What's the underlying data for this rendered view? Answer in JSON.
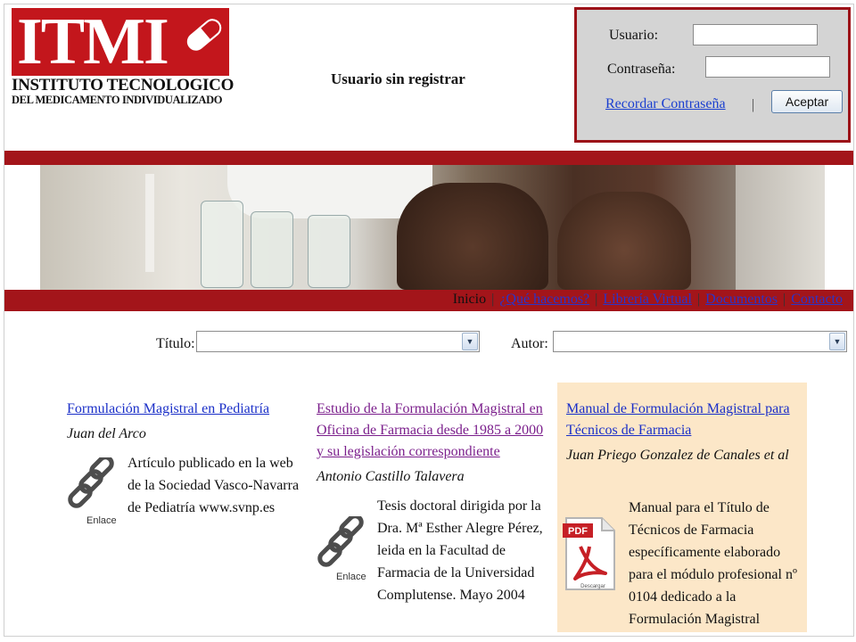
{
  "header": {
    "logo_main": "ITMI",
    "logo_sub1": "INSTITUTO TECNOLOGICO",
    "logo_sub2": "DEL MEDICAMENTO INDIVIDUALIZADO",
    "user_status": "Usuario sin registrar"
  },
  "login": {
    "user_label": "Usuario:",
    "user_value": "",
    "password_label": "Contraseña:",
    "password_value": "",
    "remember_link": "Recordar Contraseña",
    "separator": "|",
    "accept_button": "Aceptar"
  },
  "nav": {
    "items": [
      "Inicio",
      "¿Qué hacemos?",
      "Librería Virtual",
      "Documentos",
      "Contacto"
    ],
    "separator": "|"
  },
  "filters": {
    "title_label": "Título:",
    "title_value": "",
    "author_label": "Autor:",
    "author_value": ""
  },
  "items": [
    {
      "title": "Formulación Magistral en Pediatría",
      "author": "Juan del Arco",
      "description": "Artículo publicado en la web de la Sociedad Vasco-Navarra de Pediatría www.svnp.es",
      "link_type": "Enlace",
      "icon": "chain-link-icon",
      "title_color": "#1a2fc8"
    },
    {
      "title": "Estudio de la Formulación Magistral en Oficina de Farmacia desde 1985 a 2000 y su legislación correspondiente",
      "author": "Antonio Castillo Talavera",
      "description": "Tesis doctoral dirigida por la Dra. Mª Esther Alegre Pérez, leida en la Facultad de Farmacia de la Universidad Complutense. Mayo 2004",
      "link_type": "Enlace",
      "icon": "chain-link-icon",
      "title_color": "#7b1f8c"
    },
    {
      "title": "Manual de Formulación Magistral para Técnicos de Farmacia",
      "author": "Juan Priego Gonzalez de Canales et al",
      "description": "Manual para el Título de Técnicos de Farmacia específicamente elaborado para el módulo profesional nº 0104 dedicado a la Formulación Magistral",
      "link_type": "Descargar",
      "icon": "pdf-download-icon",
      "title_color": "#1a2fc8",
      "highlight_color": "#fce7c8"
    }
  ],
  "colors": {
    "brand_red": "#c3161c",
    "bar_red": "#a3151a",
    "link_blue": "#1a2fc8"
  }
}
